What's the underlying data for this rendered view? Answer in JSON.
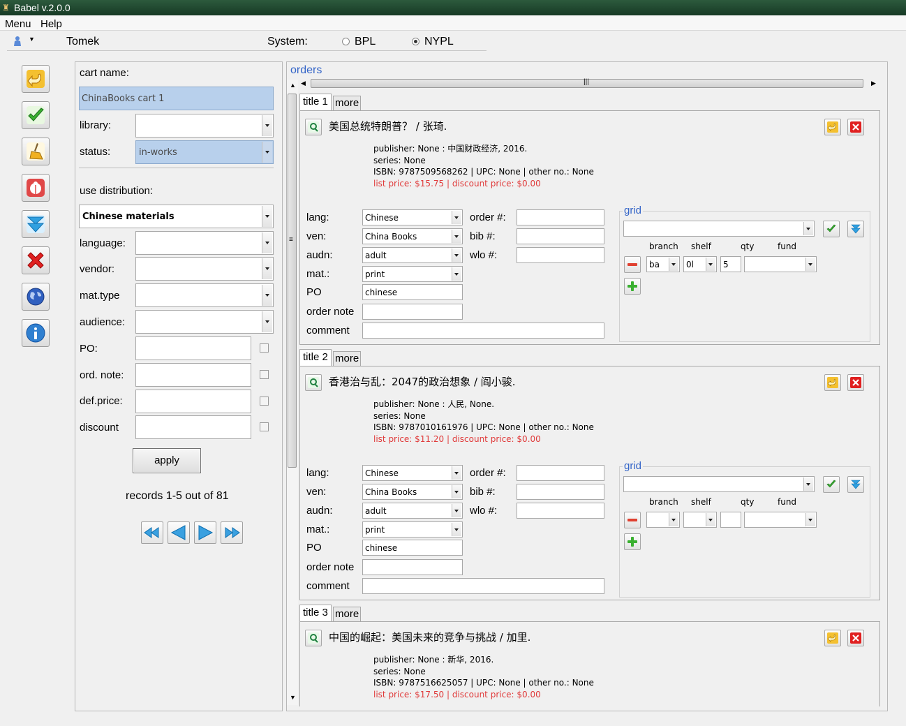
{
  "window": {
    "title": "Babel v.2.0.0"
  },
  "menu": {
    "items": [
      "Menu",
      "Help"
    ]
  },
  "top": {
    "user": "Tomek",
    "system_label": "System:",
    "systems": [
      "BPL",
      "NYPL"
    ],
    "selected_system": "NYPL"
  },
  "left_toolbar": {
    "buttons": [
      {
        "name": "back-icon",
        "color": "#f0b020"
      },
      {
        "name": "approve-icon",
        "color": "#3ab030"
      },
      {
        "name": "broom-icon",
        "color": "#e8a020"
      },
      {
        "name": "bug-icon",
        "color": "#e04040"
      },
      {
        "name": "download-icon",
        "color": "#30a0e0"
      },
      {
        "name": "delete-icon",
        "color": "#e02020"
      },
      {
        "name": "globe-icon",
        "color": "#3060c0"
      },
      {
        "name": "info-icon",
        "color": "#3080d0"
      }
    ]
  },
  "cart": {
    "name_label": "cart name:",
    "name_value": "ChinaBooks cart 1",
    "library_label": "library:",
    "library_value": "",
    "status_label": "status:",
    "status_value": "in-works",
    "use_distribution_label": "use distribution:",
    "distribution_value": "Chinese materials",
    "language_label": "language:",
    "vendor_label": "vendor:",
    "mattype_label": "mat.type",
    "audience_label": "audience:",
    "po_label": "PO:",
    "ordnote_label": "ord. note:",
    "defprice_label": "def.price:",
    "discount_label": "discount",
    "apply_label": "apply",
    "records_text": "records 1-5 out of 81"
  },
  "orders": {
    "section_label": "orders",
    "more_label": "more",
    "grid_label": "grid",
    "field_labels": {
      "lang": "lang:",
      "ven": "ven:",
      "audn": "audn:",
      "mat": "mat.:",
      "po": "PO",
      "order_note": "order note",
      "comment": "comment",
      "order_no": "order #:",
      "bib_no": "bib #:",
      "wlo_no": "wlo #:"
    },
    "grid_columns": [
      "branch",
      "shelf",
      "qty",
      "fund"
    ],
    "titles": [
      {
        "tab": "title 1",
        "heading": "美国总统特朗普？ / 张琦.",
        "publisher": "publisher: None : 中国财政经济, 2016.",
        "series": "series: None",
        "ids": "ISBN: 9787509568262 | UPC: None | other no.: None",
        "price": "list price: $15.75 | discount price: $0.00",
        "lang": "Chinese",
        "ven": "China Books",
        "audn": "adult",
        "mat": "print",
        "po": "chinese",
        "grid_branch": "ba",
        "grid_shelf": "0l",
        "grid_qty": "5"
      },
      {
        "tab": "title 2",
        "heading": "香港治与乱：2047的政治想象 / 阎小骏.",
        "publisher": "publisher: None : 人民, None.",
        "series": "series: None",
        "ids": "ISBN: 9787010161976 | UPC: None | other no.: None",
        "price": "list price: $11.20 | discount price: $0.00",
        "lang": "Chinese",
        "ven": "China Books",
        "audn": "adult",
        "mat": "print",
        "po": "chinese",
        "grid_branch": "",
        "grid_shelf": "",
        "grid_qty": ""
      },
      {
        "tab": "title 3",
        "heading": "中国的崛起：美国未来的竞争与挑战 / 加里.",
        "publisher": "publisher: None : 新华, 2016.",
        "series": "series: None",
        "ids": "ISBN: 9787516625057 | UPC: None | other no.: None",
        "price": "list price: $17.50 | discount price: $0.00"
      }
    ]
  }
}
